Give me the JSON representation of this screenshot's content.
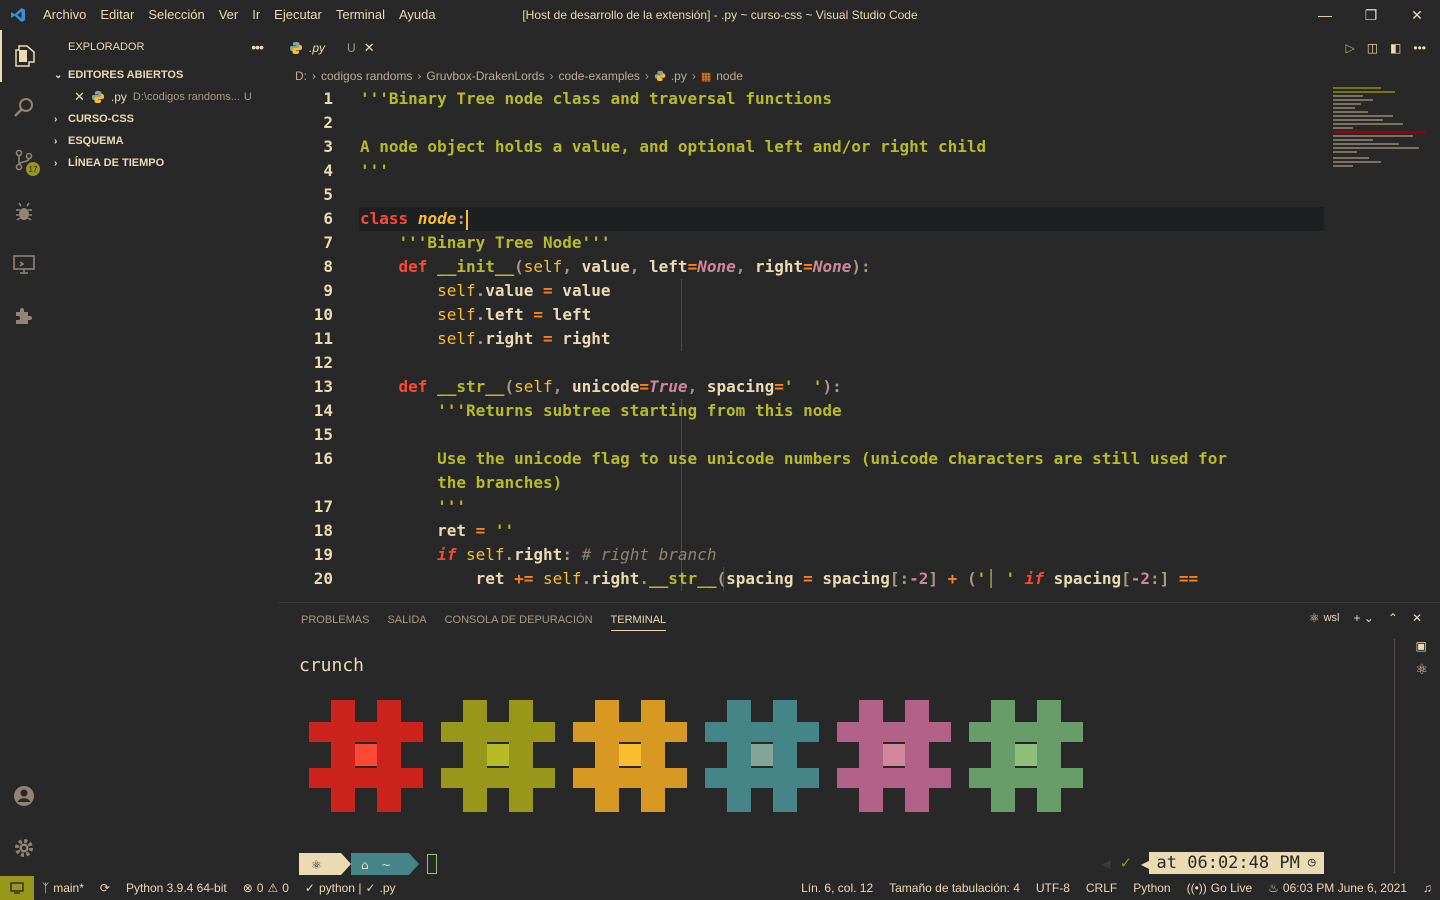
{
  "menu": [
    "Archivo",
    "Editar",
    "Selección",
    "Ver",
    "Ir",
    "Ejecutar",
    "Terminal",
    "Ayuda"
  ],
  "window_title": "[Host de desarrollo de la extensión] - .py ~ curso-css ~ Visual Studio Code",
  "activity_badge": "17",
  "sidebar": {
    "title": "EXPLORADOR",
    "open_editors": "EDITORES ABIERTOS",
    "open_file": {
      "name": ".py",
      "path": "D:\\codigos randoms...",
      "status": "U"
    },
    "folder": "CURSO-CSS",
    "outline": "ESQUEMA",
    "timeline": "LÍNEA DE TIEMPO"
  },
  "tab": {
    "name": ".py",
    "status": "U"
  },
  "breadcrumb": [
    "D:",
    "codigos randoms",
    "Gruvbox-DrakenLords",
    "code-examples",
    ".py",
    "node"
  ],
  "panel": {
    "tabs": [
      "PROBLEMAS",
      "SALIDA",
      "CONSOLA DE DEPURACIÓN",
      "TERMINAL"
    ],
    "shell": "wsl",
    "terminal_title": "crunch",
    "clock": "at 06:02:48 PM"
  },
  "hash_colors": [
    {
      "main": "#cc241d",
      "center": "#fb4934"
    },
    {
      "main": "#98971a",
      "center": "#b8bb26"
    },
    {
      "main": "#d79921",
      "center": "#fabd2f"
    },
    {
      "main": "#458588",
      "center": "#83a598"
    },
    {
      "main": "#b16286",
      "center": "#d3869b"
    },
    {
      "main": "#689d6a",
      "center": "#8ec07c"
    }
  ],
  "status": {
    "branch": "main*",
    "interpreter": "Python 3.9.4 64-bit",
    "errors": "0",
    "warnings": "0",
    "lint": "python | ",
    "lint_file": ".py",
    "position": "Lín. 6, col. 12",
    "tab_size": "Tamaño de tabulación: 4",
    "encoding": "UTF-8",
    "eol": "CRLF",
    "language": "Python",
    "live": "Go Live",
    "datetime": "06:03 PM  June 6, 2021"
  },
  "code_lines": [
    "1",
    "2",
    "3",
    "4",
    "5",
    "6",
    "7",
    "8",
    "9",
    "10",
    "11",
    "12",
    "13",
    "14",
    "15",
    "16",
    "",
    "17",
    "18",
    "19",
    "20"
  ]
}
